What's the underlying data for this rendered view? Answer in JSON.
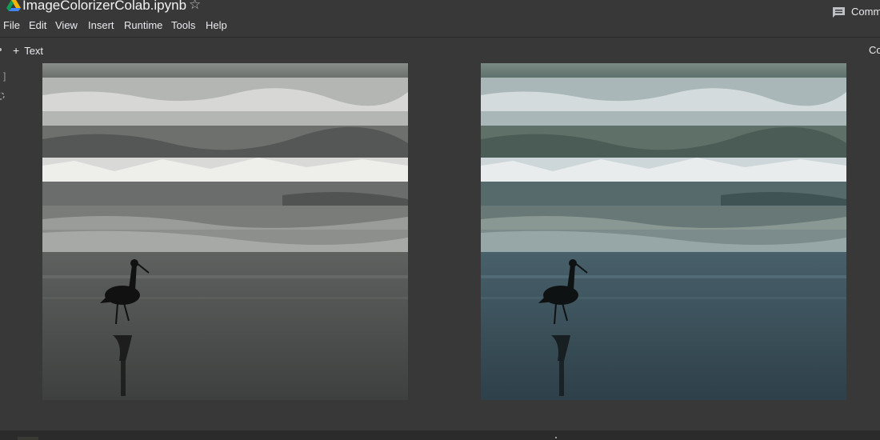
{
  "window": {
    "title": "ImageColorizerColab.ipynb",
    "star_icon": "star-outline-icon",
    "drive_icon": "google-drive-icon"
  },
  "header": {
    "comment_label": "Comm",
    "comment_icon": "comment-icon"
  },
  "menu": {
    "items": [
      "File",
      "Edit",
      "View",
      "Insert",
      "Runtime",
      "Tools",
      "Help"
    ]
  },
  "toolbar": {
    "add_text_label": "Text",
    "add_text_icon": "plus-icon",
    "right_label": "Co"
  },
  "gutter": {
    "bracket": "]",
    "run_icon": "cell-run-icon"
  },
  "output": {
    "images": [
      {
        "name": "grayscale-input-image",
        "description_icon": "beach-bird-photo-grayscale"
      },
      {
        "name": "colorized-output-image",
        "description_icon": "beach-bird-photo-colorized"
      }
    ]
  },
  "colors": {
    "background": "#383838",
    "text": "#e8eaed",
    "drive_yellow": "#f4b400",
    "drive_green": "#0f9d58",
    "drive_blue": "#4285f4"
  }
}
